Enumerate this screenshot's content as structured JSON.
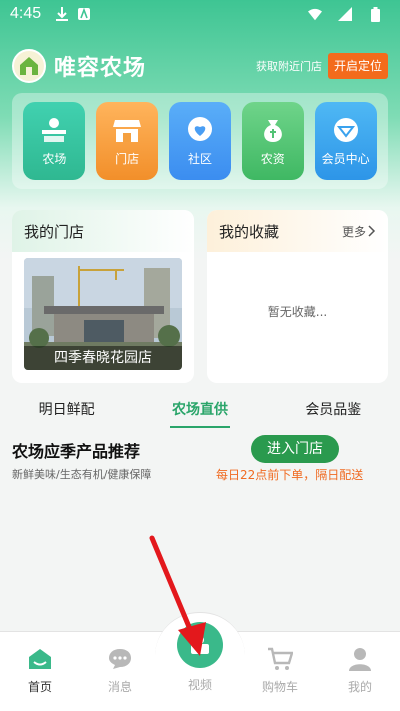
{
  "status_bar": {
    "time": "4:45"
  },
  "header": {
    "app_name": "唯容农场",
    "nearby_text": "获取附近门店",
    "locate_button": "开启定位"
  },
  "categories": [
    {
      "label": "农场",
      "icon": "farm-icon"
    },
    {
      "label": "门店",
      "icon": "store-icon"
    },
    {
      "label": "社区",
      "icon": "community-icon"
    },
    {
      "label": "农资",
      "icon": "supplies-icon"
    },
    {
      "label": "会员中心",
      "icon": "member-icon"
    }
  ],
  "my_store": {
    "title": "我的门店",
    "store_name": "四季春晓花园店"
  },
  "favorites": {
    "title": "我的收藏",
    "more": "更多",
    "empty": "暂无收藏..."
  },
  "tabs": [
    {
      "label": "明日鲜配",
      "active": false
    },
    {
      "label": "农场直供",
      "active": true
    },
    {
      "label": "会员品鉴",
      "active": false
    }
  ],
  "season": {
    "title": "农场应季产品推荐",
    "subtitle": "新鲜美味/生态有机/健康保障",
    "enter_button": "进入门店",
    "delivery": "每日22点前下单，隔日配送"
  },
  "bottom_nav": {
    "home": "首页",
    "messages": "消息",
    "video": "视频",
    "cart": "购物车",
    "mine": "我的"
  },
  "colors": {
    "accent": "#2aa56a",
    "orange": "#f36b1c",
    "arrow": "#e3181c"
  }
}
